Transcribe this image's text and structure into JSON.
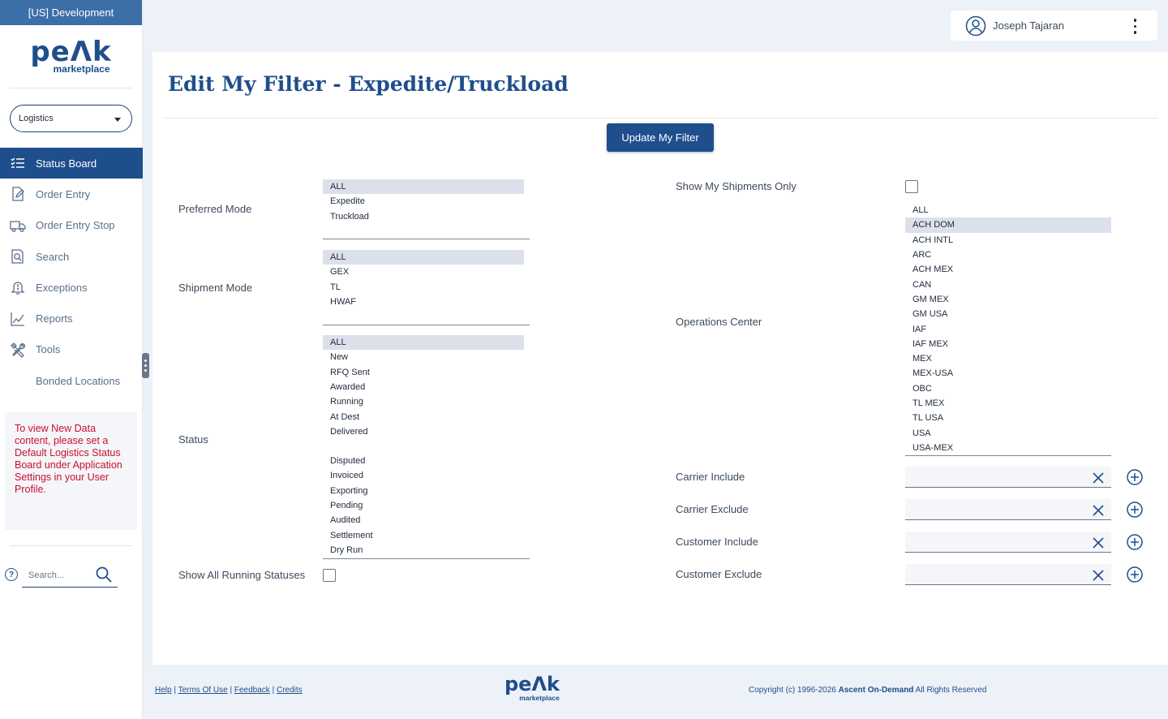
{
  "env_label": "[US] Development",
  "logo": {
    "word": "peΛk",
    "sub": "marketplace"
  },
  "department": {
    "selected": "Logistics"
  },
  "nav": [
    {
      "label": "Status Board",
      "icon": "list-check-icon",
      "active": true
    },
    {
      "label": "Order Entry",
      "icon": "edit-doc-icon"
    },
    {
      "label": "Order Entry Stop",
      "icon": "truck-icon"
    },
    {
      "label": "Search",
      "icon": "search-doc-icon"
    },
    {
      "label": "Exceptions",
      "icon": "alert-bell-icon"
    },
    {
      "label": "Reports",
      "icon": "chart-line-icon"
    },
    {
      "label": "Tools",
      "icon": "tools-icon"
    },
    {
      "label": "Bonded Locations",
      "icon": ""
    }
  ],
  "notice": "To view New Data content, please set a Default Logistics Status Board under Application Settings in your User Profile.",
  "sidebar_search": {
    "placeholder": "Search..."
  },
  "help_glyph": "?",
  "user": {
    "name": "Joseph Tajaran"
  },
  "page": {
    "title": "Edit My Filter - Expedite/Truckload"
  },
  "update_button": "Update My Filter",
  "filters": {
    "preferred_mode": {
      "label": "Preferred Mode",
      "options": [
        "ALL",
        "Expedite",
        "Truckload"
      ],
      "selected": [
        "ALL"
      ]
    },
    "shipment_mode": {
      "label": "Shipment Mode",
      "options": [
        "ALL",
        "GEX",
        "TL",
        "HWAF"
      ],
      "selected": [
        "ALL"
      ]
    },
    "status": {
      "label": "Status",
      "options_top": [
        "ALL",
        "New",
        "RFQ Sent",
        "Awarded",
        "Running",
        "At Dest",
        "Delivered"
      ],
      "options_bottom": [
        "Disputed",
        "Invoiced",
        "Exporting",
        "Pending",
        "Audited",
        "Settlement",
        "Dry Run"
      ],
      "selected": [
        "ALL"
      ]
    },
    "show_all_running": {
      "label": "Show All Running Statuses",
      "checked": false
    },
    "show_my_shipments": {
      "label": "Show My Shipments Only",
      "checked": false
    },
    "operations_center": {
      "label": "Operations Center",
      "options": [
        "ALL",
        "ACH DOM",
        "ACH INTL",
        "ARC",
        "ACH MEX",
        "CAN",
        "GM MEX",
        "GM USA",
        "IAF",
        "IAF MEX",
        "MEX",
        "MEX-USA",
        "OBC",
        "TL MEX",
        "TL USA",
        "USA",
        "USA-MEX"
      ],
      "selected": [
        "ACH DOM"
      ]
    },
    "carrier_include": {
      "label": "Carrier Include"
    },
    "carrier_exclude": {
      "label": "Carrier Exclude"
    },
    "customer_include": {
      "label": "Customer Include"
    },
    "customer_exclude": {
      "label": "Customer Exclude"
    }
  },
  "footer": {
    "links": [
      "Help",
      "Terms Of Use",
      "Feedback",
      "Credits"
    ],
    "separator": "|",
    "copyright_prefix": "Copyright (c) 1996-2026 ",
    "copyright_company": "Ascent On-Demand",
    "copyright_suffix": " All Rights Reserved"
  },
  "colors": {
    "primary": "#1f4e8c",
    "env_bar": "#3c6ea8",
    "notice_text": "#c8102e",
    "background": "#edf1f8"
  }
}
